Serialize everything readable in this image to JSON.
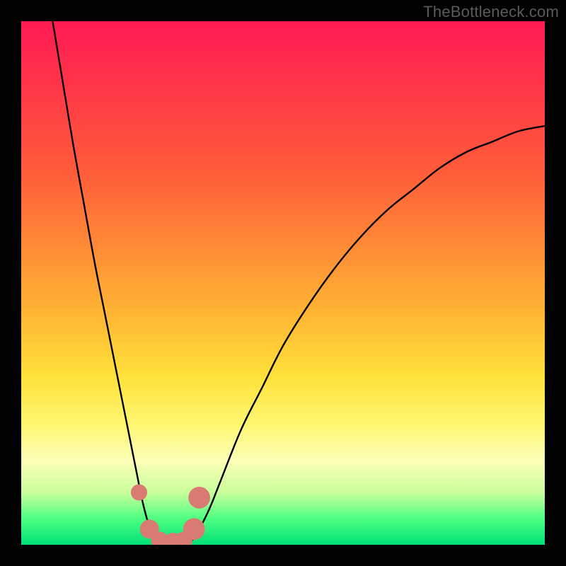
{
  "credit": "TheBottleneck.com",
  "chart_data": {
    "type": "line",
    "title": "",
    "xlabel": "",
    "ylabel": "",
    "xlim": [
      0,
      100
    ],
    "ylim": [
      0,
      100
    ],
    "series": [
      {
        "name": "left-branch",
        "x": [
          6,
          8,
          10,
          12,
          14,
          16,
          18,
          20,
          22,
          23,
          24,
          25,
          26
        ],
        "values": [
          100,
          88,
          76,
          65,
          54,
          44,
          34,
          24,
          14,
          9,
          5,
          2,
          0
        ]
      },
      {
        "name": "right-branch",
        "x": [
          32,
          34,
          36,
          38,
          42,
          46,
          50,
          55,
          60,
          65,
          70,
          75,
          80,
          85,
          90,
          95,
          100
        ],
        "values": [
          0,
          3,
          7,
          12,
          22,
          30,
          38,
          46,
          53,
          59,
          64,
          68,
          72,
          75,
          77,
          79,
          80
        ]
      },
      {
        "name": "valley-floor",
        "x": [
          26,
          27,
          28,
          29,
          30,
          31,
          32
        ],
        "values": [
          0,
          0,
          0,
          0,
          0,
          0,
          0
        ]
      }
    ],
    "markers": [
      {
        "name": "marker-left-upper",
        "x": 22.5,
        "y": 10,
        "r": 1.2
      },
      {
        "name": "marker-left-lower",
        "x": 24.5,
        "y": 3,
        "r": 1.4
      },
      {
        "name": "marker-floor-1",
        "x": 26.5,
        "y": 0.8,
        "r": 1.3
      },
      {
        "name": "marker-floor-2",
        "x": 29,
        "y": 0.6,
        "r": 1.3
      },
      {
        "name": "marker-floor-3",
        "x": 31,
        "y": 0.8,
        "r": 1.3
      },
      {
        "name": "marker-right-lower",
        "x": 33,
        "y": 3,
        "r": 1.6
      },
      {
        "name": "marker-right-upper",
        "x": 34,
        "y": 9,
        "r": 1.6
      }
    ],
    "marker_color": "#d97a73",
    "curve_color": "#000000",
    "gradient_stops": [
      {
        "pos": 0,
        "color": "#ff1a53"
      },
      {
        "pos": 28,
        "color": "#ff5a3a"
      },
      {
        "pos": 55,
        "color": "#ffb233"
      },
      {
        "pos": 68,
        "color": "#ffe23a"
      },
      {
        "pos": 77,
        "color": "#fff772"
      },
      {
        "pos": 84,
        "color": "#fcffb8"
      },
      {
        "pos": 90,
        "color": "#c9ff9a"
      },
      {
        "pos": 95,
        "color": "#4eff82"
      },
      {
        "pos": 100,
        "color": "#00e076"
      }
    ]
  }
}
